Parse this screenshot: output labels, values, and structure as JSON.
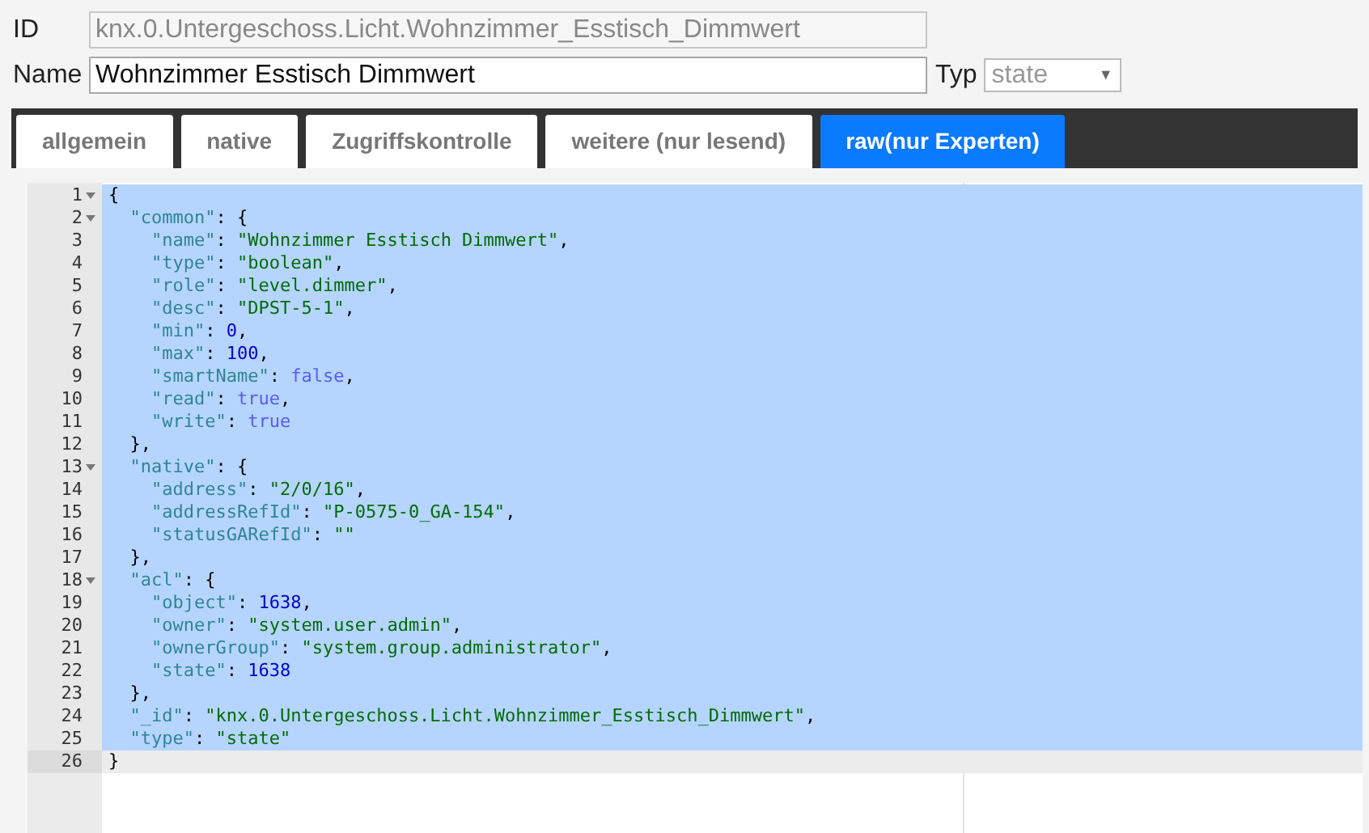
{
  "id_field": {
    "label": "ID",
    "value": "knx.0.Untergeschoss.Licht.Wohnzimmer_Esstisch_Dimmwert",
    "disabled": true
  },
  "name_field": {
    "label": "Name",
    "value": "Wohnzimmer Esstisch Dimmwert"
  },
  "type_select": {
    "label": "Typ",
    "value": "state",
    "caret": "▼"
  },
  "tabs": [
    {
      "label": "allgemein",
      "selected": false
    },
    {
      "label": "native",
      "selected": false
    },
    {
      "label": "Zugriffskontrolle",
      "selected": false
    },
    {
      "label": "weitere (nur lesend)",
      "selected": false
    },
    {
      "label": "raw(nur Experten)",
      "selected": true
    }
  ],
  "editor": {
    "lines": [
      {
        "number": "1",
        "foldable": true,
        "selected": true,
        "active": false,
        "tokens": [
          {
            "kind": "punct",
            "text": "{"
          }
        ]
      },
      {
        "number": "2",
        "foldable": true,
        "selected": true,
        "active": false,
        "tokens": [
          {
            "kind": "key",
            "text": "  \"common\""
          },
          {
            "kind": "punct",
            "text": ": {"
          }
        ]
      },
      {
        "number": "3",
        "foldable": false,
        "selected": true,
        "active": false,
        "tokens": [
          {
            "kind": "key",
            "text": "    \"name\""
          },
          {
            "kind": "punct",
            "text": ": "
          },
          {
            "kind": "string",
            "text": "\"Wohnzimmer Esstisch Dimmwert\""
          },
          {
            "kind": "punct",
            "text": ","
          }
        ]
      },
      {
        "number": "4",
        "foldable": false,
        "selected": true,
        "active": false,
        "tokens": [
          {
            "kind": "key",
            "text": "    \"type\""
          },
          {
            "kind": "punct",
            "text": ": "
          },
          {
            "kind": "string",
            "text": "\"boolean\""
          },
          {
            "kind": "punct",
            "text": ","
          }
        ]
      },
      {
        "number": "5",
        "foldable": false,
        "selected": true,
        "active": false,
        "tokens": [
          {
            "kind": "key",
            "text": "    \"role\""
          },
          {
            "kind": "punct",
            "text": ": "
          },
          {
            "kind": "string",
            "text": "\"level.dimmer\""
          },
          {
            "kind": "punct",
            "text": ","
          }
        ]
      },
      {
        "number": "6",
        "foldable": false,
        "selected": true,
        "active": false,
        "tokens": [
          {
            "kind": "key",
            "text": "    \"desc\""
          },
          {
            "kind": "punct",
            "text": ": "
          },
          {
            "kind": "string",
            "text": "\"DPST-5-1\""
          },
          {
            "kind": "punct",
            "text": ","
          }
        ]
      },
      {
        "number": "7",
        "foldable": false,
        "selected": true,
        "active": false,
        "tokens": [
          {
            "kind": "key",
            "text": "    \"min\""
          },
          {
            "kind": "punct",
            "text": ": "
          },
          {
            "kind": "number",
            "text": "0"
          },
          {
            "kind": "punct",
            "text": ","
          }
        ]
      },
      {
        "number": "8",
        "foldable": false,
        "selected": true,
        "active": false,
        "tokens": [
          {
            "kind": "key",
            "text": "    \"max\""
          },
          {
            "kind": "punct",
            "text": ": "
          },
          {
            "kind": "number",
            "text": "100"
          },
          {
            "kind": "punct",
            "text": ","
          }
        ]
      },
      {
        "number": "9",
        "foldable": false,
        "selected": true,
        "active": false,
        "tokens": [
          {
            "kind": "key",
            "text": "    \"smartName\""
          },
          {
            "kind": "punct",
            "text": ": "
          },
          {
            "kind": "atom",
            "text": "false"
          },
          {
            "kind": "punct",
            "text": ","
          }
        ]
      },
      {
        "number": "10",
        "foldable": false,
        "selected": true,
        "active": false,
        "tokens": [
          {
            "kind": "key",
            "text": "    \"read\""
          },
          {
            "kind": "punct",
            "text": ": "
          },
          {
            "kind": "atom",
            "text": "true"
          },
          {
            "kind": "punct",
            "text": ","
          }
        ]
      },
      {
        "number": "11",
        "foldable": false,
        "selected": true,
        "active": false,
        "tokens": [
          {
            "kind": "key",
            "text": "    \"write\""
          },
          {
            "kind": "punct",
            "text": ": "
          },
          {
            "kind": "atom",
            "text": "true"
          }
        ]
      },
      {
        "number": "12",
        "foldable": false,
        "selected": true,
        "active": false,
        "tokens": [
          {
            "kind": "punct",
            "text": "  },"
          }
        ]
      },
      {
        "number": "13",
        "foldable": true,
        "selected": true,
        "active": false,
        "tokens": [
          {
            "kind": "key",
            "text": "  \"native\""
          },
          {
            "kind": "punct",
            "text": ": {"
          }
        ]
      },
      {
        "number": "14",
        "foldable": false,
        "selected": true,
        "active": false,
        "tokens": [
          {
            "kind": "key",
            "text": "    \"address\""
          },
          {
            "kind": "punct",
            "text": ": "
          },
          {
            "kind": "string",
            "text": "\"2/0/16\""
          },
          {
            "kind": "punct",
            "text": ","
          }
        ]
      },
      {
        "number": "15",
        "foldable": false,
        "selected": true,
        "active": false,
        "tokens": [
          {
            "kind": "key",
            "text": "    \"addressRefId\""
          },
          {
            "kind": "punct",
            "text": ": "
          },
          {
            "kind": "string",
            "text": "\"P-0575-0_GA-154\""
          },
          {
            "kind": "punct",
            "text": ","
          }
        ]
      },
      {
        "number": "16",
        "foldable": false,
        "selected": true,
        "active": false,
        "tokens": [
          {
            "kind": "key",
            "text": "    \"statusGARefId\""
          },
          {
            "kind": "punct",
            "text": ": "
          },
          {
            "kind": "string",
            "text": "\"\""
          }
        ]
      },
      {
        "number": "17",
        "foldable": false,
        "selected": true,
        "active": false,
        "tokens": [
          {
            "kind": "punct",
            "text": "  },"
          }
        ]
      },
      {
        "number": "18",
        "foldable": true,
        "selected": true,
        "active": false,
        "tokens": [
          {
            "kind": "key",
            "text": "  \"acl\""
          },
          {
            "kind": "punct",
            "text": ": {"
          }
        ]
      },
      {
        "number": "19",
        "foldable": false,
        "selected": true,
        "active": false,
        "tokens": [
          {
            "kind": "key",
            "text": "    \"object\""
          },
          {
            "kind": "punct",
            "text": ": "
          },
          {
            "kind": "number",
            "text": "1638"
          },
          {
            "kind": "punct",
            "text": ","
          }
        ]
      },
      {
        "number": "20",
        "foldable": false,
        "selected": true,
        "active": false,
        "tokens": [
          {
            "kind": "key",
            "text": "    \"owner\""
          },
          {
            "kind": "punct",
            "text": ": "
          },
          {
            "kind": "string",
            "text": "\"system.user.admin\""
          },
          {
            "kind": "punct",
            "text": ","
          }
        ]
      },
      {
        "number": "21",
        "foldable": false,
        "selected": true,
        "active": false,
        "tokens": [
          {
            "kind": "key",
            "text": "    \"ownerGroup\""
          },
          {
            "kind": "punct",
            "text": ": "
          },
          {
            "kind": "string",
            "text": "\"system.group.administrator\""
          },
          {
            "kind": "punct",
            "text": ","
          }
        ]
      },
      {
        "number": "22",
        "foldable": false,
        "selected": true,
        "active": false,
        "tokens": [
          {
            "kind": "key",
            "text": "    \"state\""
          },
          {
            "kind": "punct",
            "text": ": "
          },
          {
            "kind": "number",
            "text": "1638"
          }
        ]
      },
      {
        "number": "23",
        "foldable": false,
        "selected": true,
        "active": false,
        "tokens": [
          {
            "kind": "punct",
            "text": "  },"
          }
        ]
      },
      {
        "number": "24",
        "foldable": false,
        "selected": true,
        "active": false,
        "tokens": [
          {
            "kind": "key",
            "text": "  \"_id\""
          },
          {
            "kind": "punct",
            "text": ": "
          },
          {
            "kind": "string",
            "text": "\"knx.0.Untergeschoss.Licht.Wohnzimmer_Esstisch_Dimmwert\""
          },
          {
            "kind": "punct",
            "text": ","
          }
        ]
      },
      {
        "number": "25",
        "foldable": false,
        "selected": true,
        "active": false,
        "tokens": [
          {
            "kind": "key",
            "text": "  \"type\""
          },
          {
            "kind": "punct",
            "text": ": "
          },
          {
            "kind": "string",
            "text": "\"state\""
          }
        ]
      },
      {
        "number": "26",
        "foldable": false,
        "selected": false,
        "active": true,
        "tokens": [
          {
            "kind": "punct",
            "text": "}"
          }
        ]
      }
    ]
  }
}
